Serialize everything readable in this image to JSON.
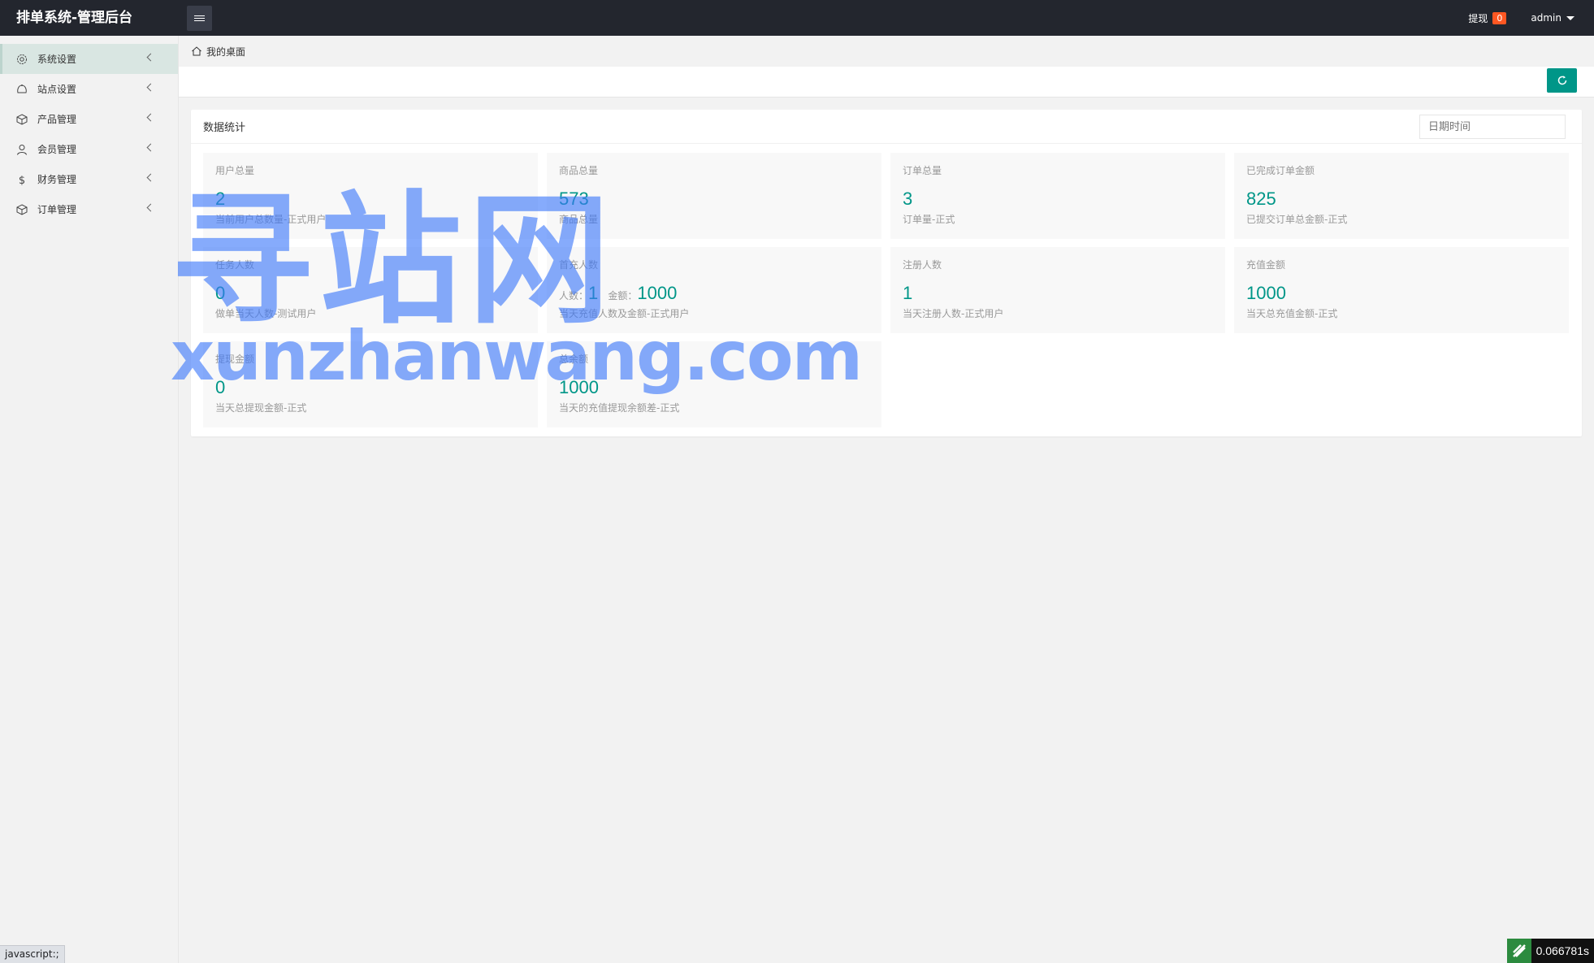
{
  "header": {
    "title": "排单系统-管理后台",
    "withdraw_label": "提现",
    "withdraw_count": "0",
    "user_name": "admin"
  },
  "sidebar": {
    "items": [
      {
        "label": "系统设置",
        "icon": "gear-icon"
      },
      {
        "label": "站点设置",
        "icon": "site-icon"
      },
      {
        "label": "产品管理",
        "icon": "box-icon"
      },
      {
        "label": "会员管理",
        "icon": "user-icon"
      },
      {
        "label": "财务管理",
        "icon": "dollar-icon"
      },
      {
        "label": "订单管理",
        "icon": "order-icon"
      }
    ]
  },
  "breadcrumb": {
    "home_label": "我的桌面"
  },
  "panel": {
    "title": "数据统计",
    "date_placeholder": "日期时间",
    "cards": [
      {
        "title": "用户总量",
        "value": "2",
        "desc": "当前用户总数量-正式用户"
      },
      {
        "title": "商品总量",
        "value": "573",
        "desc": "商品总量"
      },
      {
        "title": "订单总量",
        "value": "3",
        "desc": "订单量-正式"
      },
      {
        "title": "已完成订单金额",
        "value": "825",
        "desc": "已提交订单总金额-正式"
      },
      {
        "title": "任务人数",
        "value": "0",
        "desc": "做单当天人数-测试用户"
      },
      {
        "title": "首充人数",
        "count_label": "人数：",
        "count_value": "1",
        "amount_label": "金额：",
        "amount_value": "1000",
        "desc": "当天充值人数及金额-正式用户"
      },
      {
        "title": "注册人数",
        "value": "1",
        "desc": "当天注册人数-正式用户"
      },
      {
        "title": "充值金额",
        "value": "1000",
        "desc": "当天总充值金额-正式"
      },
      {
        "title": "提现金额",
        "value": "0",
        "desc": "当天总提现金额-正式"
      },
      {
        "title": "总余额",
        "value": "1000",
        "desc": "当天的充值提现余额差-正式"
      }
    ]
  },
  "watermark": {
    "cn": "寻站网",
    "en": "xunzhanwang.com"
  },
  "status": {
    "url": "javascript:;",
    "timer": "0.066781s"
  },
  "colors": {
    "accent": "#009688",
    "header_bg": "#23262e",
    "badge": "#ff5722",
    "watermark": "#3c78fa"
  }
}
